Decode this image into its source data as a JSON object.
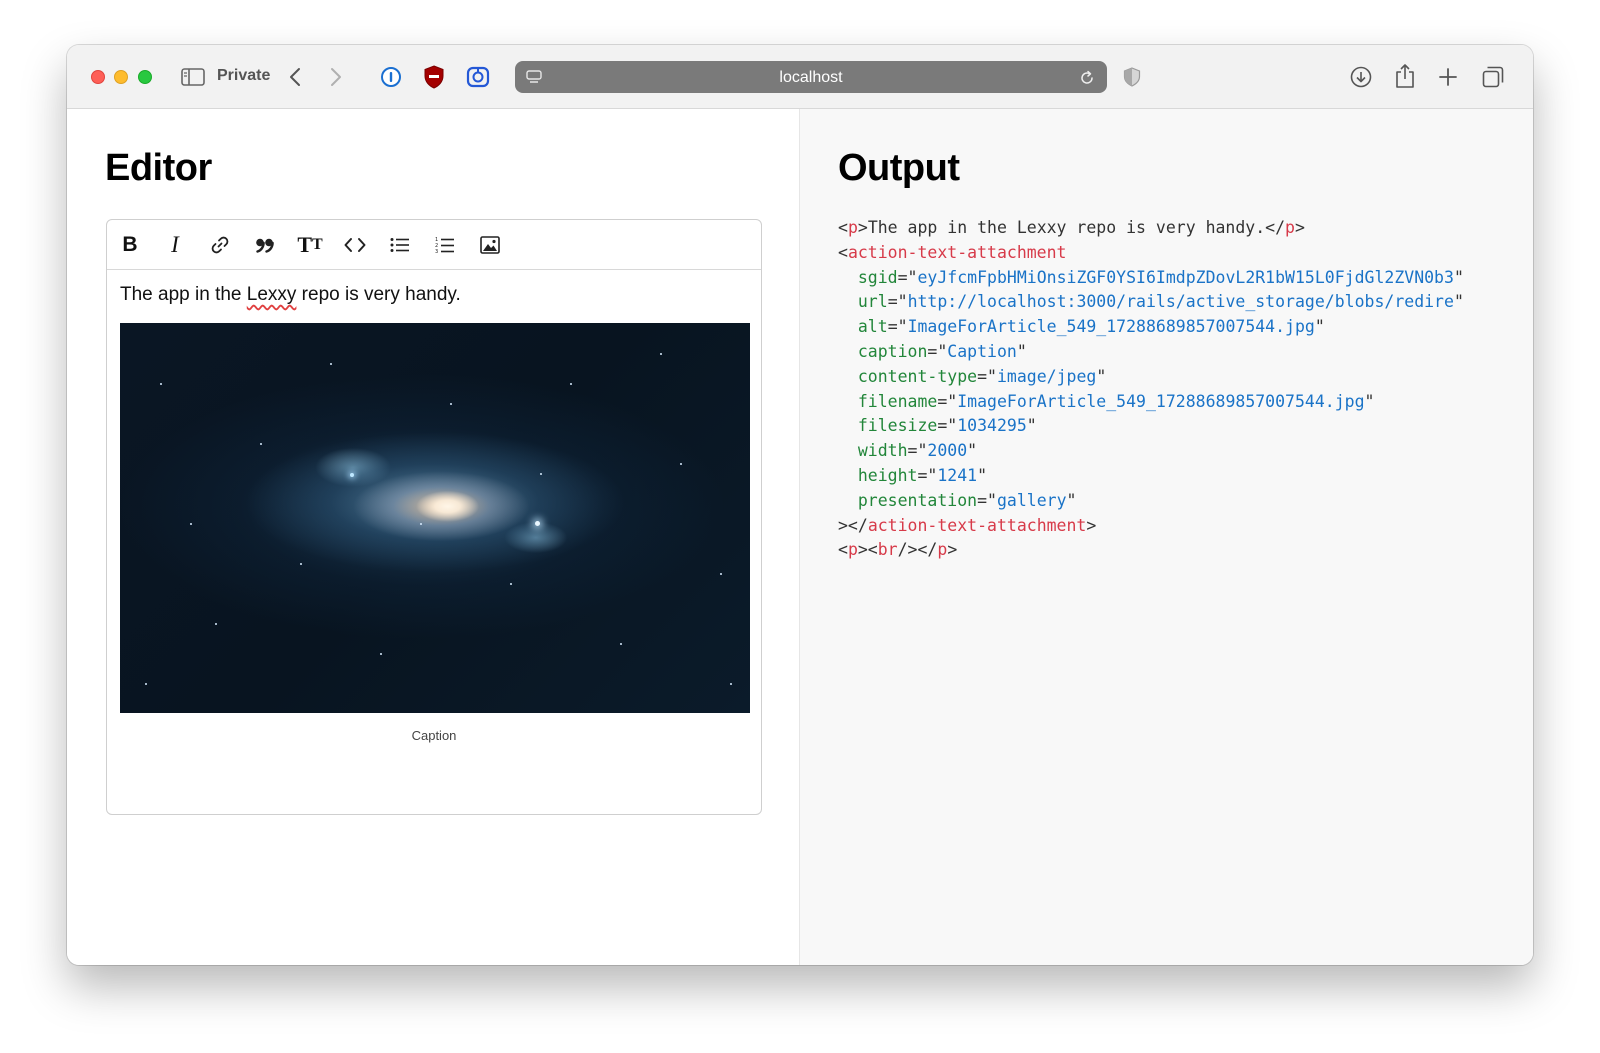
{
  "browser": {
    "private_label": "Private",
    "url": "localhost"
  },
  "editor": {
    "heading": "Editor",
    "toolbar": {
      "bold": "B",
      "italic": "I",
      "heading": "TT"
    },
    "paragraph_before": "The app in the ",
    "paragraph_spell": "Lexxy",
    "paragraph_after": " repo is very handy.",
    "image_caption": "Caption"
  },
  "output": {
    "heading": "Output",
    "p_open": "<p>",
    "p_text": "The app in the Lexxy repo is very handy.",
    "p_close": "</p>",
    "tag_open": "<",
    "tag_name": "action-text-attachment",
    "attributes": [
      {
        "name": "sgid",
        "value": "eyJfcmFpbHMiOnsiZGF0YSI6ImdpZDovL2R1bW15L0FjdGl2ZVN0b3"
      },
      {
        "name": "url",
        "value": "http://localhost:3000/rails/active_storage/blobs/redire"
      },
      {
        "name": "alt",
        "value": "ImageForArticle_549_17288689857007544.jpg"
      },
      {
        "name": "caption",
        "value": "Caption"
      },
      {
        "name": "content-type",
        "value": "image/jpeg"
      },
      {
        "name": "filename",
        "value": "ImageForArticle_549_17288689857007544.jpg"
      },
      {
        "name": "filesize",
        "value": "1034295"
      },
      {
        "name": "width",
        "value": "2000"
      },
      {
        "name": "height",
        "value": "1241"
      },
      {
        "name": "presentation",
        "value": "gallery"
      }
    ],
    "close_start": "></",
    "close_end": ">",
    "last_line": "<p><br/></p>"
  }
}
